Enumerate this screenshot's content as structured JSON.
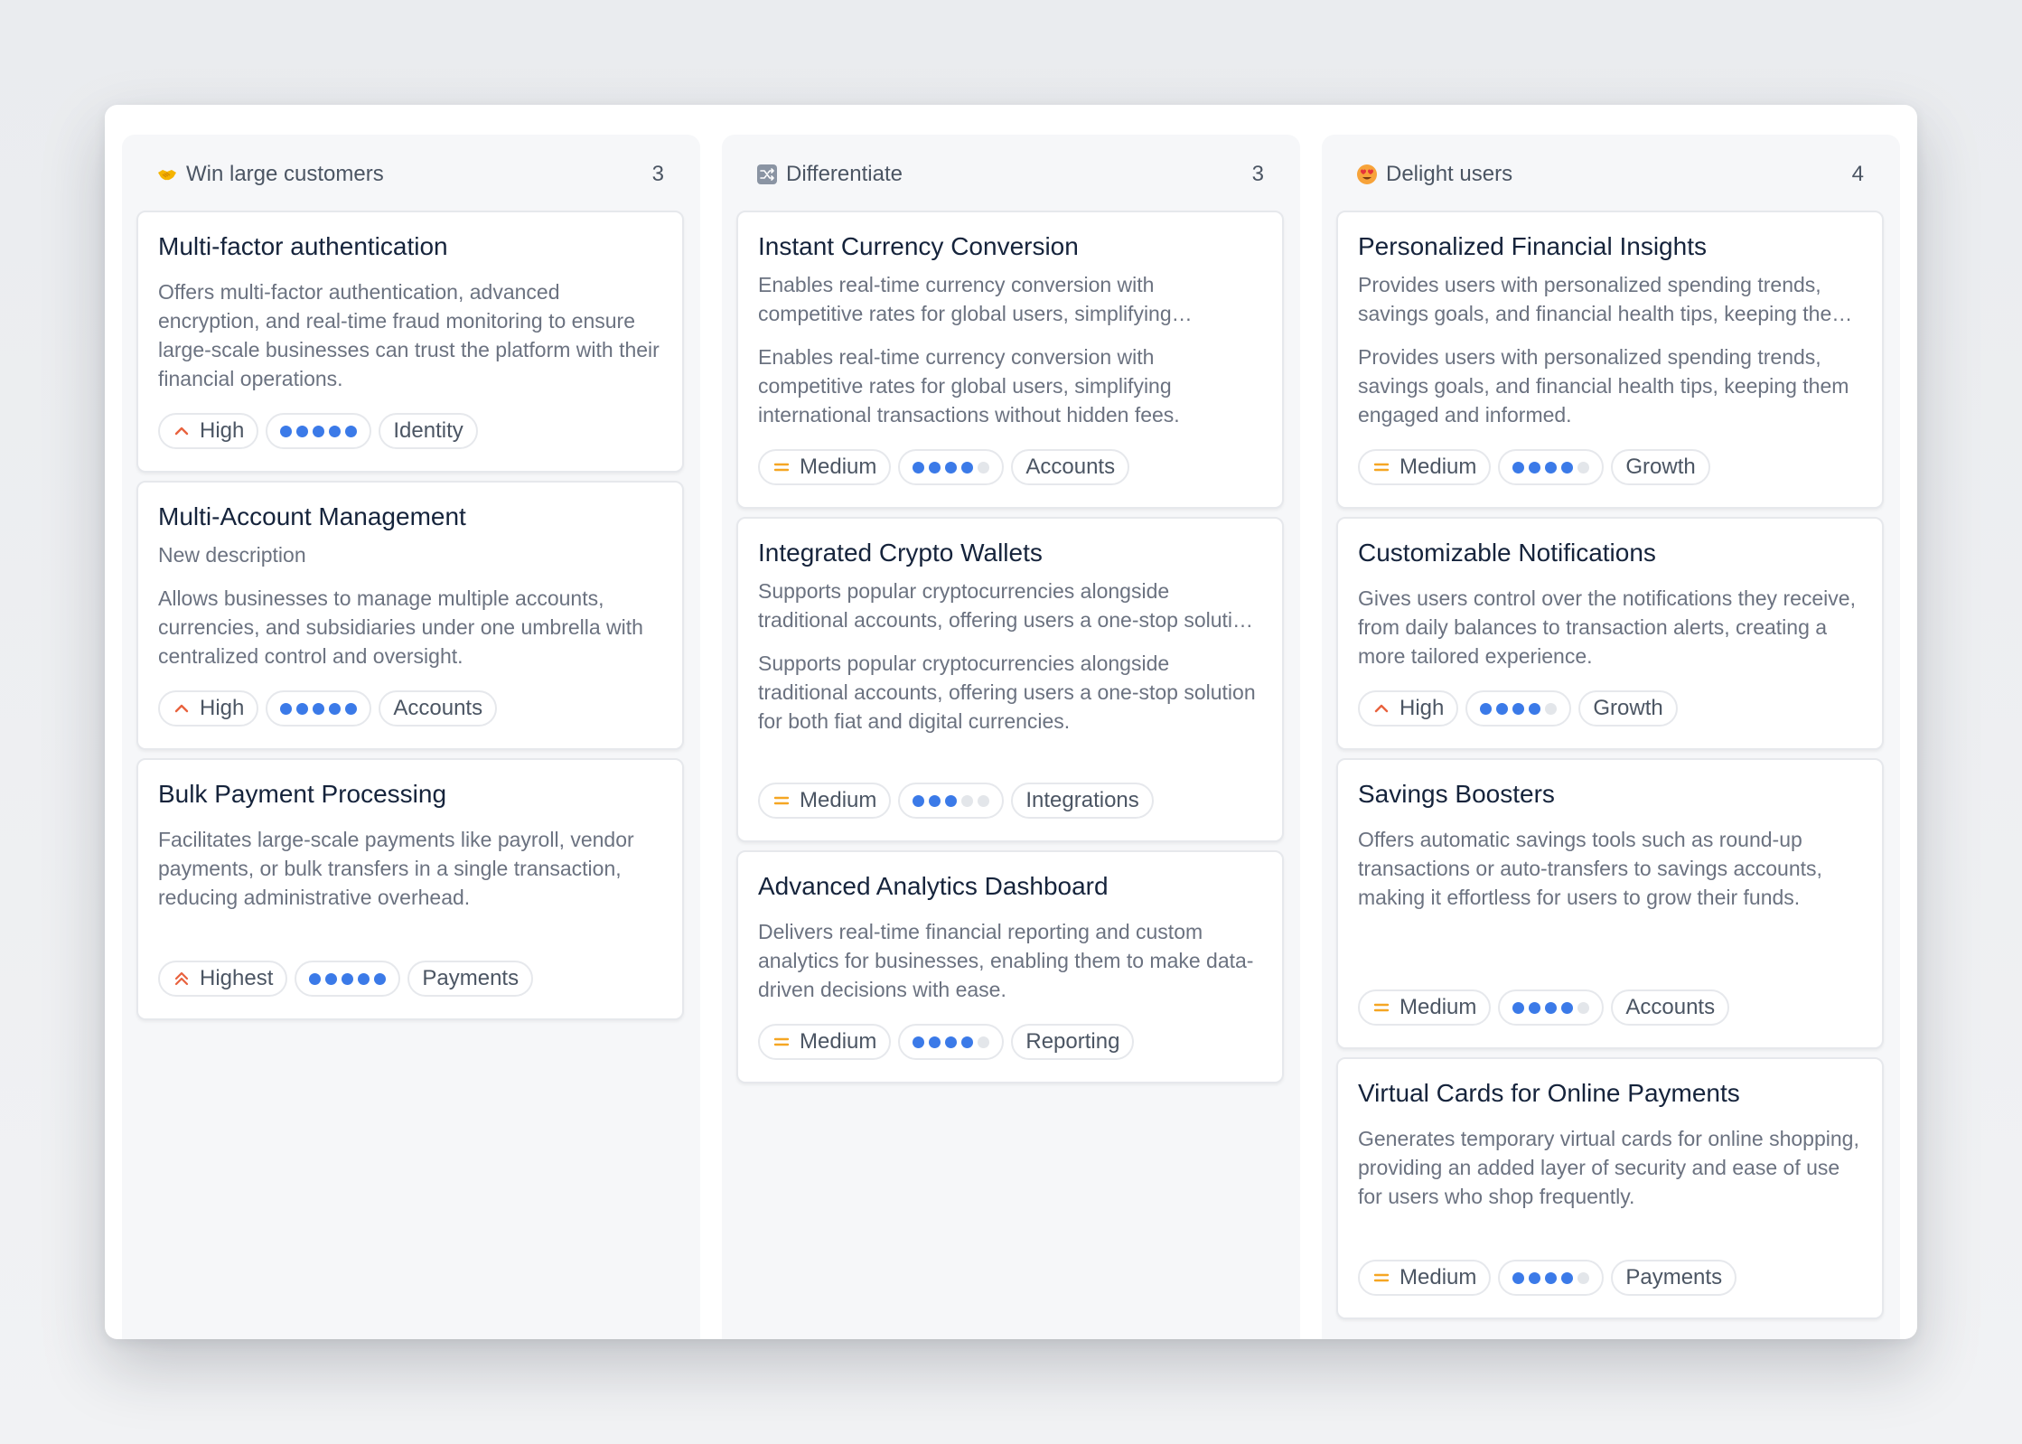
{
  "columns": [
    {
      "title": "Win large customers",
      "count": "3",
      "icon": "handshake-icon",
      "cards": [
        {
          "title": "Multi-factor authentication",
          "description": "Offers multi-factor authentication, advanced encryption, and real-time fraud monitoring to ensure large-scale businesses can trust the platform with their financial operations.",
          "priority": "High",
          "effort": 5,
          "effort_max": 5,
          "tag": "Identity"
        },
        {
          "title": "Multi-Account Management",
          "subtitle": "New description",
          "description": "Allows businesses to manage multiple accounts, currencies, and subsidiaries under one umbrella with centralized control and oversight.",
          "priority": "High",
          "effort": 5,
          "effort_max": 5,
          "tag": "Accounts"
        },
        {
          "title": "Bulk Payment Processing",
          "description": "Facilitates large-scale payments like payroll, vendor payments, or bulk transfers in a single transaction, reducing administrative overhead.",
          "priority": "Highest",
          "effort": 5,
          "effort_max": 5,
          "tag": "Payments"
        }
      ]
    },
    {
      "title": "Differentiate",
      "count": "3",
      "icon": "shuffle-icon",
      "cards": [
        {
          "title": "Instant Currency Conversion",
          "subtitle": "Enables real-time currency conversion with competitive rates for global users, simplifying international transactions without hidden fees.",
          "description": "Enables real-time currency conversion with competitive rates for global users, simplifying international transactions without hidden fees.",
          "priority": "Medium",
          "effort": 4,
          "effort_max": 5,
          "tag": "Accounts"
        },
        {
          "title": "Integrated Crypto Wallets",
          "subtitle": "Supports popular cryptocurrencies alongside traditional accounts, offering users a one-stop solution for both fiat and digital currencies.",
          "description": "Supports popular cryptocurrencies alongside traditional accounts, offering users a one-stop solution for both fiat and digital currencies.",
          "priority": "Medium",
          "effort": 3,
          "effort_max": 5,
          "tag": "Integrations"
        },
        {
          "title": "Advanced Analytics Dashboard",
          "description": "Delivers real-time financial reporting and custom analytics for businesses, enabling them to make data-driven decisions with ease.",
          "priority": "Medium",
          "effort": 4,
          "effort_max": 5,
          "tag": "Reporting"
        }
      ]
    },
    {
      "title": "Delight users",
      "count": "4",
      "icon": "heart-eyes-icon",
      "cards": [
        {
          "title": "Personalized Financial Insights",
          "subtitle": "Provides users with personalized spending trends, savings goals, and financial health tips, keeping them engaged and informed.",
          "description": "Provides users with personalized spending trends, savings goals, and financial health tips, keeping them engaged and informed.",
          "priority": "Medium",
          "effort": 4,
          "effort_max": 5,
          "tag": "Growth"
        },
        {
          "title": "Customizable Notifications",
          "description": "Gives users control over the notifications they receive, from daily balances to transaction alerts, creating a more tailored experience.",
          "priority": "High",
          "effort": 4,
          "effort_max": 5,
          "tag": "Growth"
        },
        {
          "title": "Savings Boosters",
          "description": "Offers automatic savings tools such as round-up transactions or auto-transfers to savings accounts, making it effortless for users to grow their funds.",
          "priority": "Medium",
          "effort": 4,
          "effort_max": 5,
          "tag": "Accounts"
        },
        {
          "title": "Virtual Cards for Online Payments",
          "description": "Generates temporary virtual cards for online shopping, providing an added layer of security and ease of use for users who shop frequently.",
          "priority": "Medium",
          "effort": 4,
          "effort_max": 5,
          "tag": "Payments"
        }
      ]
    }
  ],
  "colors": {
    "high": "#e8623e",
    "medium": "#f5a623",
    "effort_dot": "#3b7ae8",
    "effort_dot_off": "#e3e6ea"
  }
}
